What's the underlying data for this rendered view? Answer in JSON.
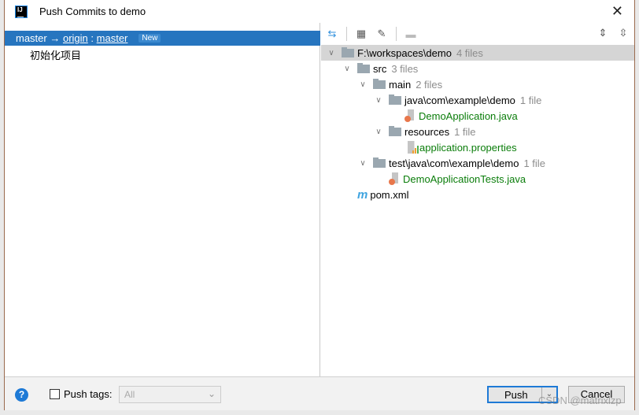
{
  "window": {
    "title": "Push Commits to demo",
    "logo_text": "IJ"
  },
  "left": {
    "branch": {
      "local": "master",
      "arrow": "→",
      "remote": "origin",
      "sep": ":",
      "remote_branch": "master",
      "badge": "New"
    },
    "commits": [
      "初始化项目"
    ]
  },
  "tree": [
    {
      "label": "F:\\workspaces\\demo",
      "count": "4 files",
      "type": "folder",
      "depth": 0
    },
    {
      "label": "src",
      "count": "3 files",
      "type": "folder",
      "depth": 1
    },
    {
      "label": "main",
      "count": "2 files",
      "type": "folder",
      "depth": 2
    },
    {
      "label": "java\\com\\example\\demo",
      "count": "1 file",
      "type": "folder",
      "depth": 3
    },
    {
      "label": "DemoApplication.java",
      "type": "java",
      "depth": 4
    },
    {
      "label": "resources",
      "count": "1 file",
      "type": "folder",
      "depth": 3
    },
    {
      "label": "application.properties",
      "type": "properties",
      "depth": 4
    },
    {
      "label": "test\\java\\com\\example\\demo",
      "count": "1 file",
      "type": "folder",
      "depth": 2
    },
    {
      "label": "DemoApplicationTests.java",
      "type": "java",
      "depth": 3
    },
    {
      "label": "pom.xml",
      "type": "maven",
      "depth": 1
    }
  ],
  "bottom": {
    "help": "?",
    "push_tags_label": "Push tags:",
    "push_tags_value": "All",
    "push": "Push",
    "cancel": "Cancel"
  },
  "watermark": "CSDN @matrixlzp"
}
